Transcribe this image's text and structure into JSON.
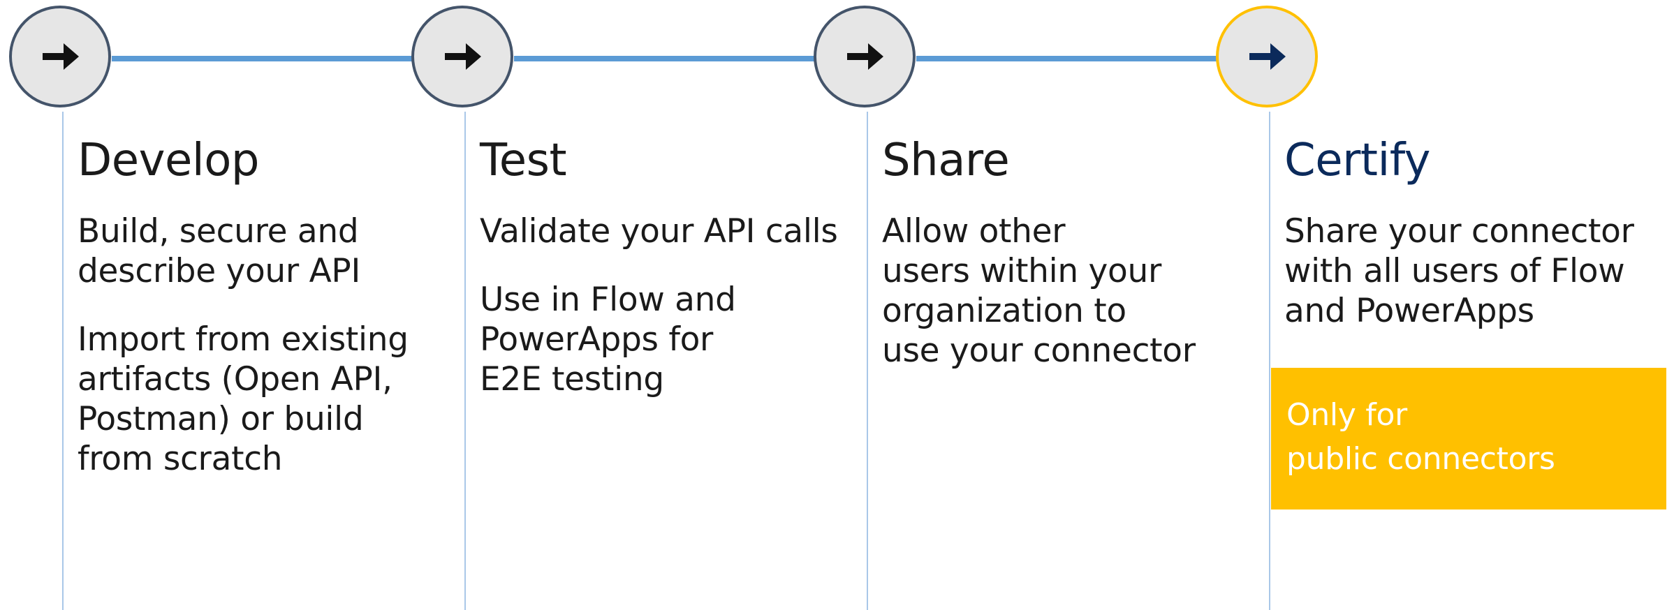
{
  "steps": [
    {
      "title": "Develop",
      "lines1": [
        "Build, secure and",
        "describe your API"
      ],
      "lines2": [
        "Import from existing",
        "artifacts (Open API,",
        "Postman) or build",
        "from scratch"
      ]
    },
    {
      "title": "Test",
      "lines1": [
        "Validate your API calls"
      ],
      "lines2": [
        "Use in Flow and",
        "PowerApps for",
        "E2E testing"
      ]
    },
    {
      "title": "Share",
      "lines1": [
        "Allow other",
        "users within your",
        "organization to",
        "use your connector"
      ]
    },
    {
      "title": "Certify",
      "lines1": [
        "Share your connector",
        "with all users of Flow",
        "and PowerApps"
      ]
    }
  ],
  "note": {
    "line1": "Only for",
    "line2": "public connectors"
  },
  "icons": {
    "step": "arrow-right-icon"
  },
  "colors": {
    "connector": "#5b9bd5",
    "circle_border": "#44546a",
    "highlight": "#ffc000",
    "certify_title": "#0b2a5b",
    "note_bg": "#ffc000"
  }
}
